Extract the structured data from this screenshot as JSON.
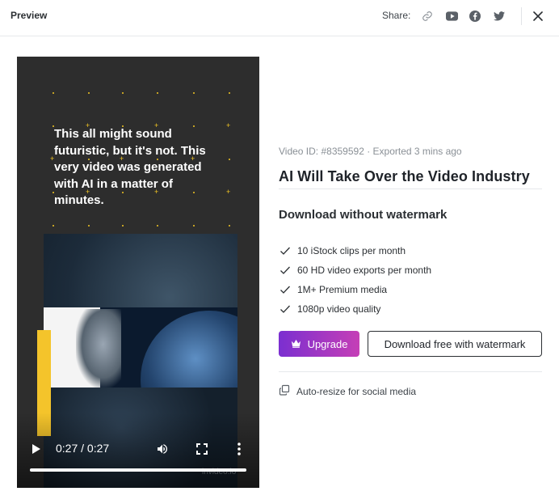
{
  "header": {
    "title": "Preview",
    "share_label": "Share:",
    "icons": [
      "link-icon",
      "youtube-icon",
      "facebook-icon",
      "twitter-icon",
      "close-icon"
    ]
  },
  "video": {
    "overlay_text": "This all might sound futuristic, but it's not. This very video was generated with AI in a matter of minutes.",
    "time": "0:27 / 0:27",
    "progress": 1.0,
    "watermark": "invideo.io",
    "accent_color": "#f4c42b"
  },
  "details": {
    "meta": "Video ID: #8359592 · Exported 3 mins ago",
    "title": "AI Will Take Over the Video Industry",
    "subtitle": "Download without watermark",
    "features": [
      "10 iStock clips per month",
      "60 HD video exports per month",
      "1M+ Premium media",
      "1080p video quality"
    ],
    "upgrade_label": "Upgrade",
    "download_free_label": "Download free with watermark",
    "auto_resize_label": "Auto-resize for social media"
  },
  "colors": {
    "upgrade_gradient_start": "#7b2fd0",
    "upgrade_gradient_end": "#c53fb6"
  }
}
